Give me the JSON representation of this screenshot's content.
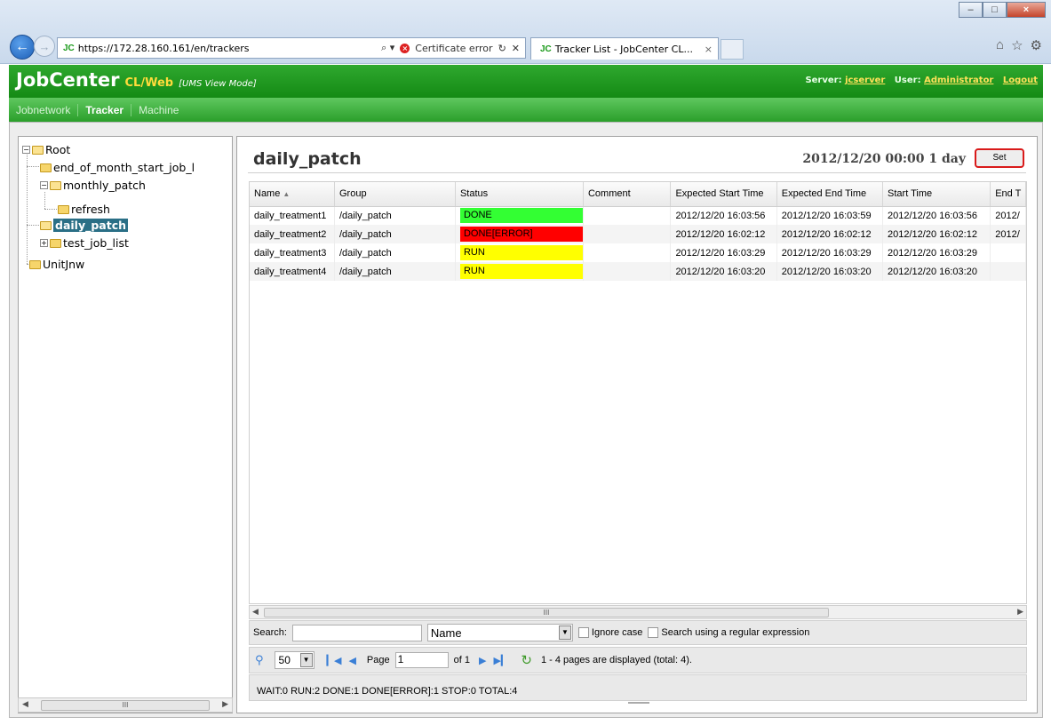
{
  "browser": {
    "url": "https://172.28.160.161/en/trackers",
    "search_glyph": "⌕ ▾",
    "cert_error": "Certificate error",
    "tab_title": "Tracker List - JobCenter CL...",
    "tab_close": "×",
    "site_logo": "JC",
    "window_buttons": {
      "minimize": "–",
      "maximize": "□",
      "close": "×"
    },
    "icons": [
      "home-icon",
      "star-icon",
      "gear-icon"
    ]
  },
  "header": {
    "brand": "JobCenter",
    "brand_sub": "CL/Web",
    "mode": "[UMS View Mode]",
    "server_label": "Server:",
    "server": "jcserver",
    "user_label": "User:",
    "user": "Administrator",
    "logout": "Logout"
  },
  "menu": {
    "items": [
      "Jobnetwork",
      "Tracker",
      "Machine"
    ],
    "active": "Tracker"
  },
  "tree": {
    "root": "Root",
    "nodes": [
      "end_of_month_start_job_l",
      "monthly_patch",
      "refresh",
      "daily_patch",
      "test_job_list",
      "UnitJnw"
    ],
    "selected": "daily_patch"
  },
  "main": {
    "title": "daily_patch",
    "schedule": "2012/12/20 00:00 1 day",
    "set_button": "Set",
    "columns": [
      "Name",
      "Group",
      "Status",
      "Comment",
      "Expected Start Time",
      "Expected End Time",
      "Start Time",
      "End T"
    ],
    "rows": [
      {
        "name": "daily_treatment1",
        "group": "/daily_patch",
        "status": "DONE",
        "status_color": "#33ff33",
        "comment": "",
        "exp_start": "2012/12/20 16:03:56",
        "exp_end": "2012/12/20 16:03:59",
        "start": "2012/12/20 16:03:56",
        "end": "2012/"
      },
      {
        "name": "daily_treatment2",
        "group": "/daily_patch",
        "status": "DONE[ERROR]",
        "status_color": "#ff0000",
        "comment": "",
        "exp_start": "2012/12/20 16:02:12",
        "exp_end": "2012/12/20 16:02:12",
        "start": "2012/12/20 16:02:12",
        "end": "2012/"
      },
      {
        "name": "daily_treatment3",
        "group": "/daily_patch",
        "status": "RUN",
        "status_color": "#ffff00",
        "comment": "",
        "exp_start": "2012/12/20 16:03:29",
        "exp_end": "2012/12/20 16:03:29",
        "start": "2012/12/20 16:03:29",
        "end": ""
      },
      {
        "name": "daily_treatment4",
        "group": "/daily_patch",
        "status": "RUN",
        "status_color": "#ffff00",
        "comment": "",
        "exp_start": "2012/12/20 16:03:20",
        "exp_end": "2012/12/20 16:03:20",
        "start": "2012/12/20 16:03:20",
        "end": ""
      }
    ],
    "scroll_thumb": "III"
  },
  "search": {
    "label": "Search:",
    "value": "",
    "field": "Name",
    "ignore_case": "Ignore case",
    "regex": "Search using a regular expression"
  },
  "pager": {
    "page_size": "50",
    "page_label": "Page",
    "page": "1",
    "of": "of 1",
    "info": "1 - 4 pages are displayed (total: 4)."
  },
  "summary": "WAIT:0 RUN:2 DONE:1 DONE[ERROR]:1 STOP:0 TOTAL:4"
}
